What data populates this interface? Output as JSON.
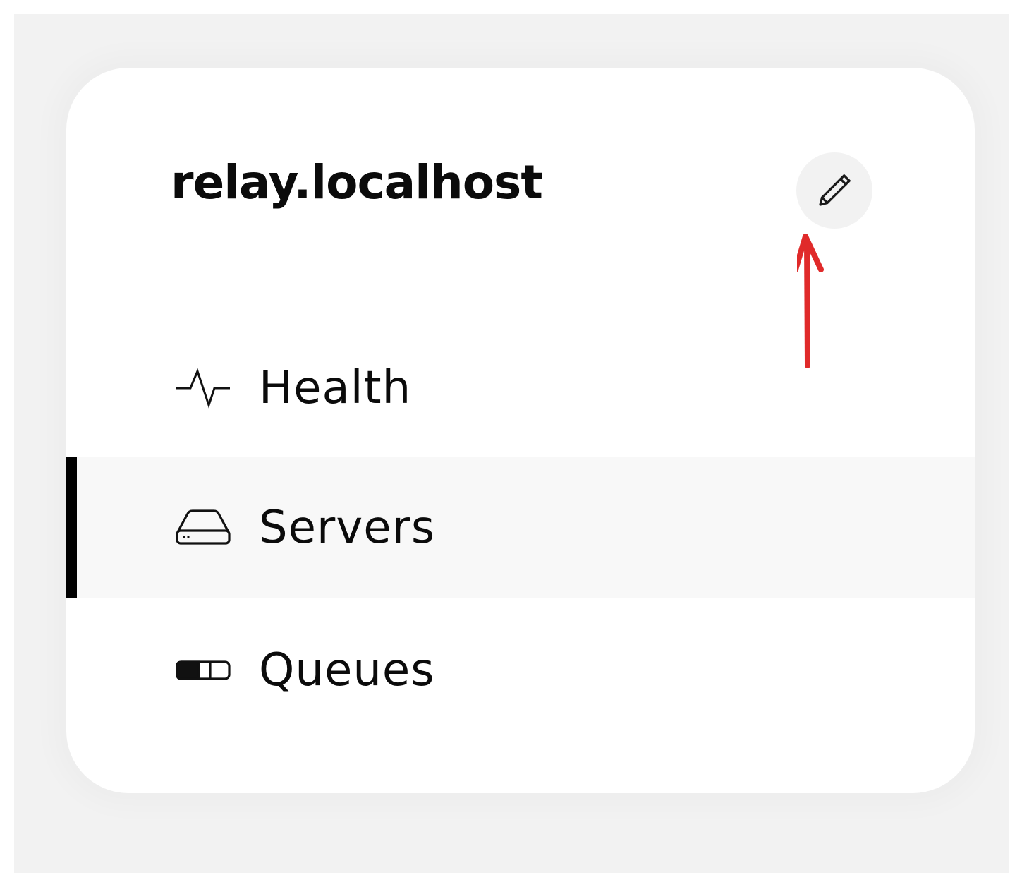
{
  "header": {
    "title": "relay.localhost",
    "edit_icon": "pencil-icon"
  },
  "nav": {
    "items": [
      {
        "label": "Health",
        "icon": "activity-icon",
        "active": false
      },
      {
        "label": "Servers",
        "icon": "server-drive-icon",
        "active": true
      },
      {
        "label": "Queues",
        "icon": "toggle-bar-icon",
        "active": false
      }
    ]
  },
  "annotation": {
    "icon": "arrow-up-icon",
    "color": "#e02a2a"
  },
  "colors": {
    "active_indicator": "#000000",
    "active_row_bg": "#f8f8f8",
    "edit_button_bg": "#f2f2f2"
  }
}
